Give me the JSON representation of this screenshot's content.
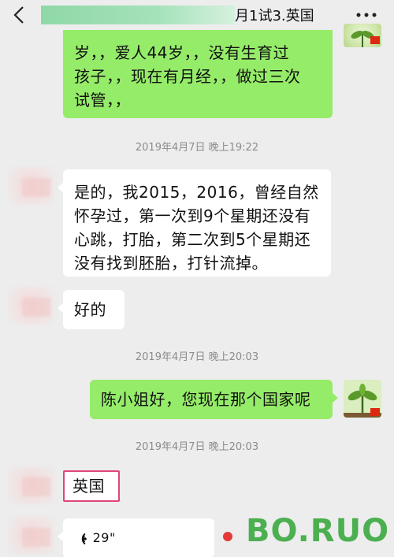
{
  "header": {
    "title_visible": "月1试3.英国",
    "back_icon": "chevron-left-icon",
    "more_icon": "more-dots-icon"
  },
  "messages": [
    {
      "side": "right",
      "lines": [
        "岁，，爱人44岁，，没有生育过",
        "孩子，，现在有月经，，做过三次",
        "试管，，"
      ]
    },
    {
      "timestamp": "2019年4月7日 晚上19:22"
    },
    {
      "side": "left",
      "lines": [
        "是的，我2015，2016，曾经自然",
        "怀孕过，第一次到9个星期还没有",
        "心跳，打胎，第二次到5个星期还",
        "没有找到胚胎，打针流掉。"
      ]
    },
    {
      "side": "left",
      "lines": [
        "好的"
      ]
    },
    {
      "timestamp": "2019年4月7日 晚上20:03"
    },
    {
      "side": "right",
      "lines": [
        "陈小姐好，您现在那个国家呢"
      ]
    },
    {
      "timestamp": "2019年4月7日 晚上20:03"
    },
    {
      "side": "left",
      "lines": [
        "英国"
      ]
    },
    {
      "side": "left",
      "voice": "29\""
    }
  ],
  "watermark": "BO.RUO",
  "colors": {
    "background": "#ededed",
    "my_bubble": "#95ec69",
    "their_bubble": "#ffffff",
    "highlight_box": "#e0457b",
    "watermark": "#4caf50"
  }
}
